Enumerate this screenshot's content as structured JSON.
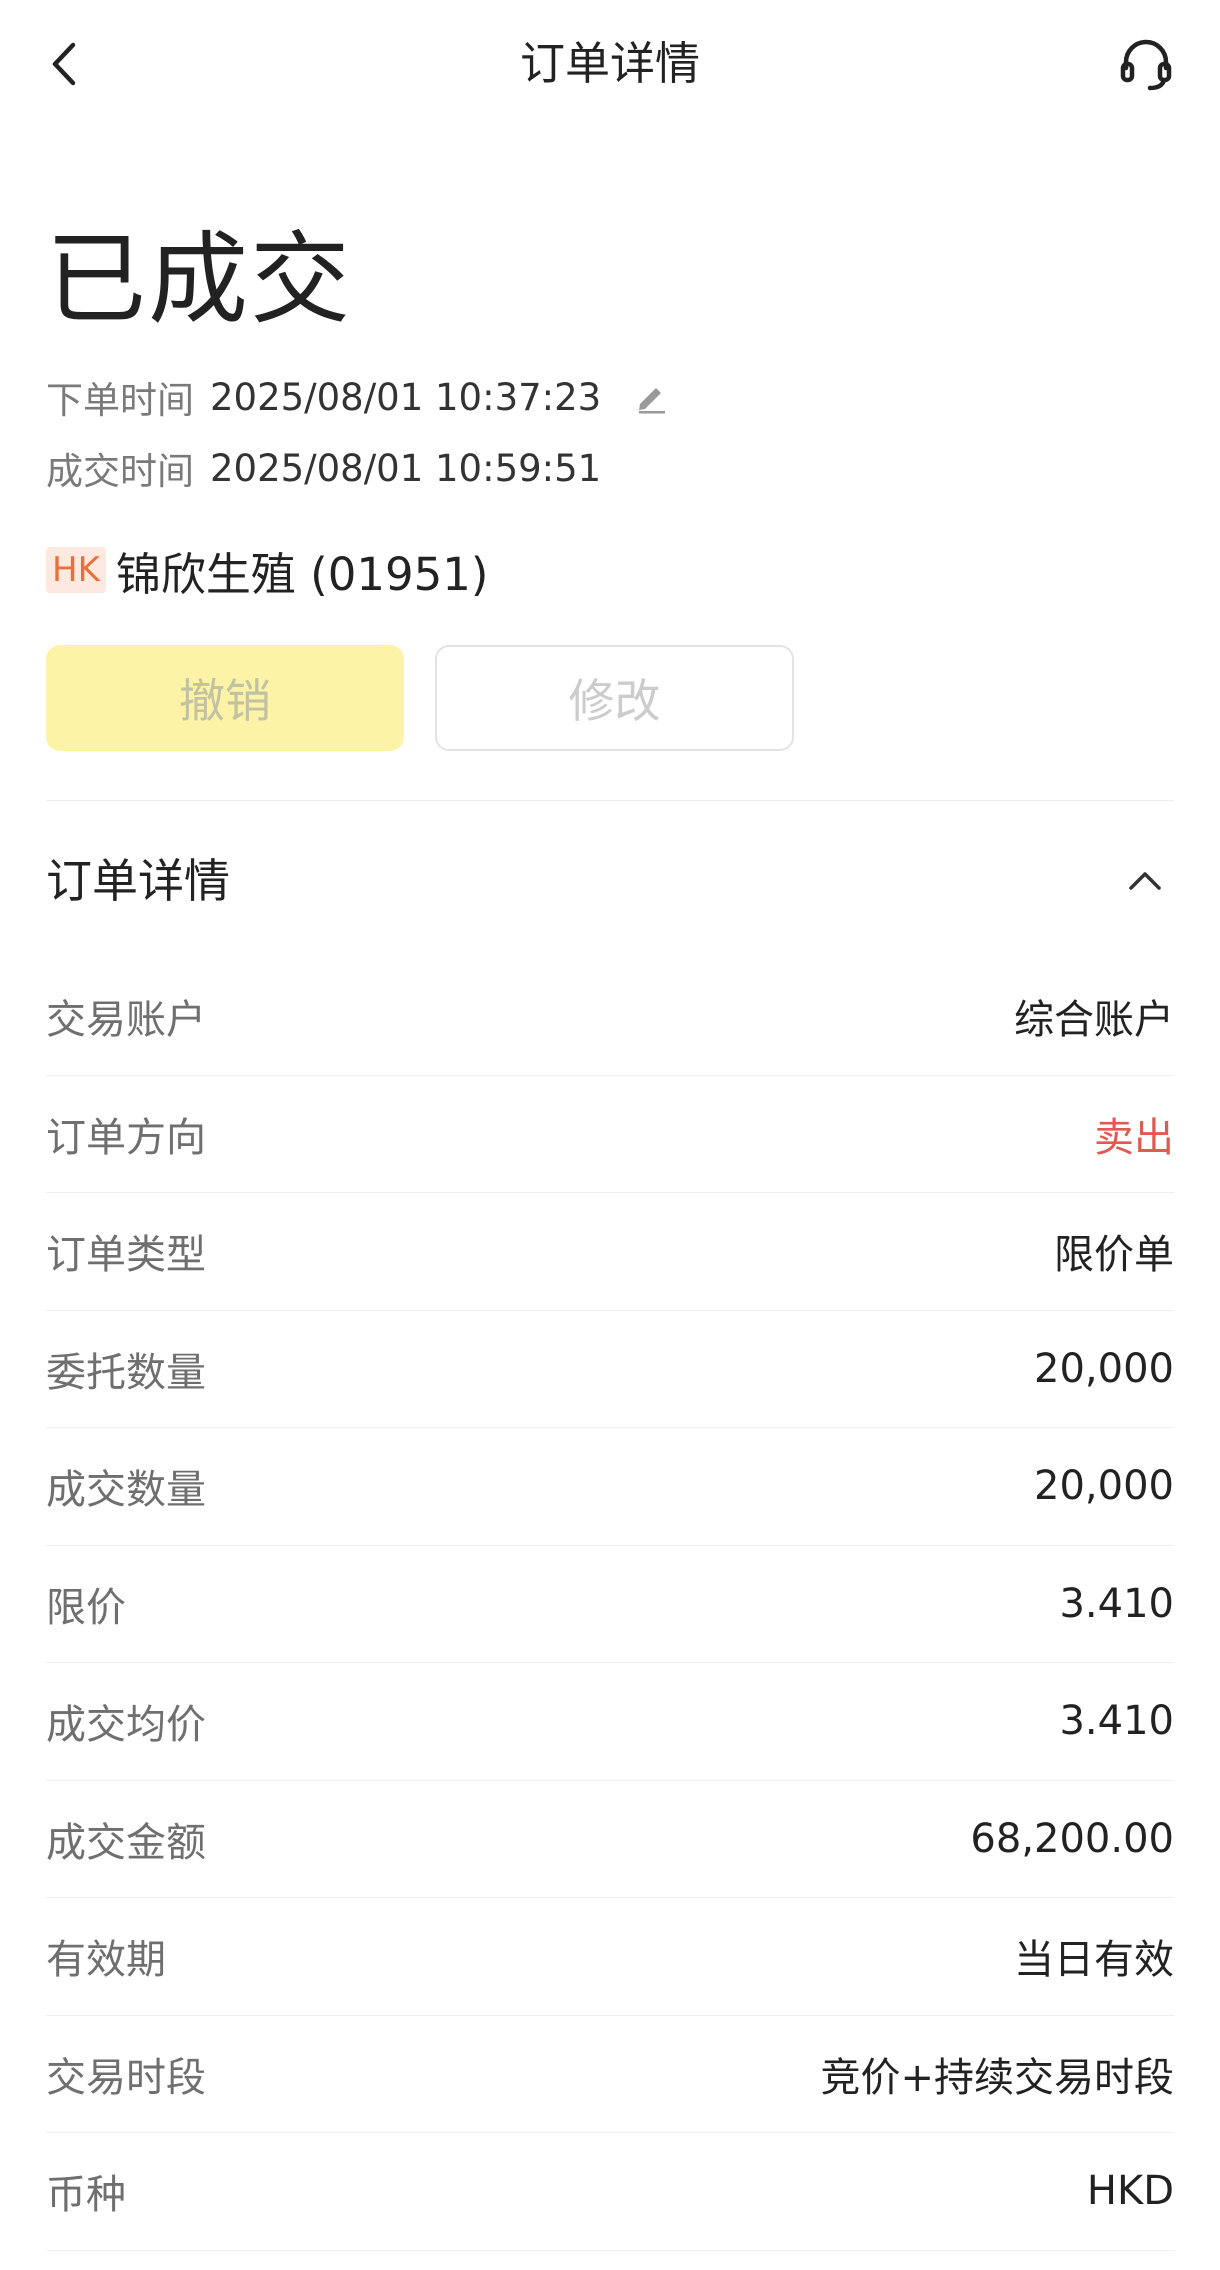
{
  "header": {
    "title": "订单详情"
  },
  "order": {
    "status": "已成交",
    "order_time_label": "下单时间",
    "order_time": "2025/08/01 10:37:23",
    "fill_time_label": "成交时间",
    "fill_time": "2025/08/01 10:59:51",
    "market_badge": "HK",
    "stock_name": "锦欣生殖 (01951)"
  },
  "actions": {
    "cancel_label": "撤销",
    "modify_label": "修改"
  },
  "details": {
    "section_title": "订单详情",
    "rows": [
      {
        "label": "交易账户",
        "value": "综合账户"
      },
      {
        "label": "订单方向",
        "value": "卖出"
      },
      {
        "label": "订单类型",
        "value": "限价单"
      },
      {
        "label": "委托数量",
        "value": "20,000"
      },
      {
        "label": "成交数量",
        "value": "20,000"
      },
      {
        "label": "限价",
        "value": "3.410"
      },
      {
        "label": "成交均价",
        "value": "3.410"
      },
      {
        "label": "成交金额",
        "value": "68,200.00"
      },
      {
        "label": "有效期",
        "value": "当日有效"
      },
      {
        "label": "交易时段",
        "value": "竞价+持续交易时段"
      },
      {
        "label": "币种",
        "value": "HKD"
      }
    ]
  },
  "colors": {
    "sell": "#e05a4f",
    "cancel_button_bg": "#fcf3a6",
    "hk_badge_bg": "#fde9e0",
    "hk_badge_text": "#e9703d"
  }
}
